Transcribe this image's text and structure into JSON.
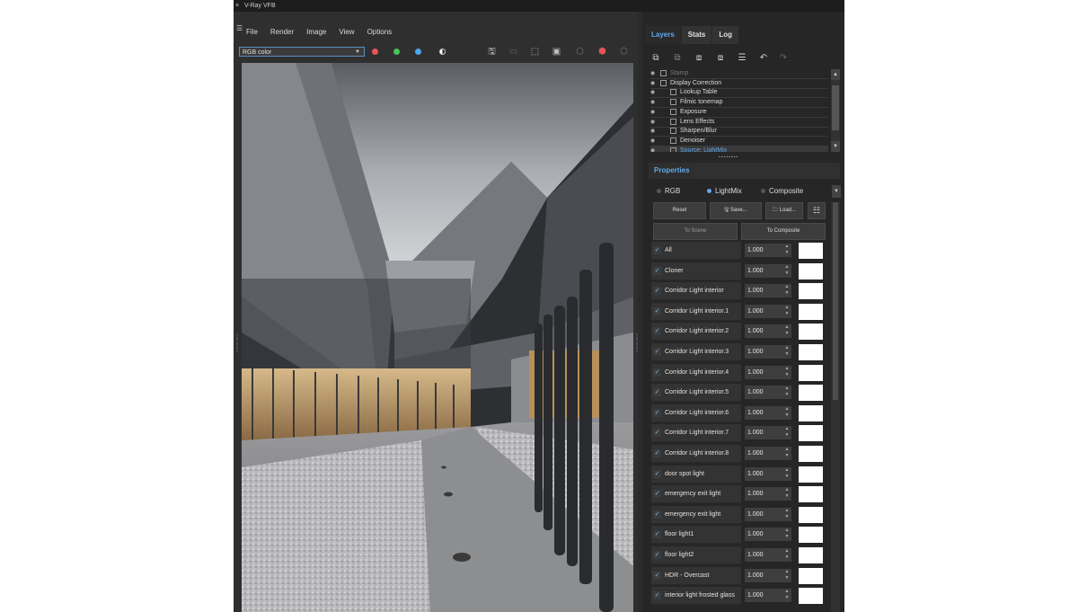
{
  "window": {
    "close_glyph": "×",
    "title": "V-Ray VFB"
  },
  "menu": [
    "File",
    "Render",
    "Image",
    "View",
    "Options"
  ],
  "toolbar": {
    "channel": "RGB color",
    "dots": [
      {
        "name": "red-channel-toggle",
        "color": "#e8555a"
      },
      {
        "name": "green-channel-toggle",
        "color": "#48c45a"
      },
      {
        "name": "blue-channel-toggle",
        "color": "#4aa6e6"
      }
    ]
  },
  "tabs": [
    "Layers",
    "Stats",
    "Log"
  ],
  "layers": [
    {
      "label": "Stamp",
      "state": "dim"
    },
    {
      "label": "Display Correction",
      "state": "normal"
    },
    {
      "label": "Lookup Table",
      "state": "child"
    },
    {
      "label": "Filmic tonemap",
      "state": "child"
    },
    {
      "label": "Exposure",
      "state": "child"
    },
    {
      "label": "Lens Effects",
      "state": "child"
    },
    {
      "label": "Sharpen/Blur",
      "state": "child"
    },
    {
      "label": "Denoiser",
      "state": "child"
    },
    {
      "label": "Source: LightMix",
      "state": "selected"
    }
  ],
  "properties": {
    "tab": "Properties",
    "modes": [
      {
        "label": "RGB",
        "selected": false
      },
      {
        "label": "LightMix",
        "selected": true
      },
      {
        "label": "Composite",
        "selected": false
      }
    ],
    "buttons": {
      "reset": "Reset",
      "save": "Save...",
      "load": "Load...",
      "to_scene": "To Scene",
      "to_composite": "To Composite"
    }
  },
  "lightmix": [
    {
      "name": "All",
      "value": "1.000"
    },
    {
      "name": "Cloner",
      "value": "1.000"
    },
    {
      "name": "Corridor Light interior",
      "value": "1.000"
    },
    {
      "name": "Corridor Light interior.1",
      "value": "1.000"
    },
    {
      "name": "Corridor Light interior.2",
      "value": "1.000"
    },
    {
      "name": "Corridor Light interior.3",
      "value": "1.000"
    },
    {
      "name": "Corridor Light interior.4",
      "value": "1.000"
    },
    {
      "name": "Corridor Light interior.5",
      "value": "1.000"
    },
    {
      "name": "Corridor Light interior.6",
      "value": "1.000"
    },
    {
      "name": "Corridor Light interior.7",
      "value": "1.000"
    },
    {
      "name": "Corridor Light interior.8",
      "value": "1.000"
    },
    {
      "name": "door spot light",
      "value": "1.000"
    },
    {
      "name": "emergency exit light",
      "value": "1.000"
    },
    {
      "name": "emergency exit light",
      "value": "1.000"
    },
    {
      "name": "floor light1",
      "value": "1.000"
    },
    {
      "name": "floor light2",
      "value": "1.000"
    },
    {
      "name": "HDR - Overcast",
      "value": "1.000"
    },
    {
      "name": "interior light frosted glass",
      "value": "1.000"
    }
  ]
}
